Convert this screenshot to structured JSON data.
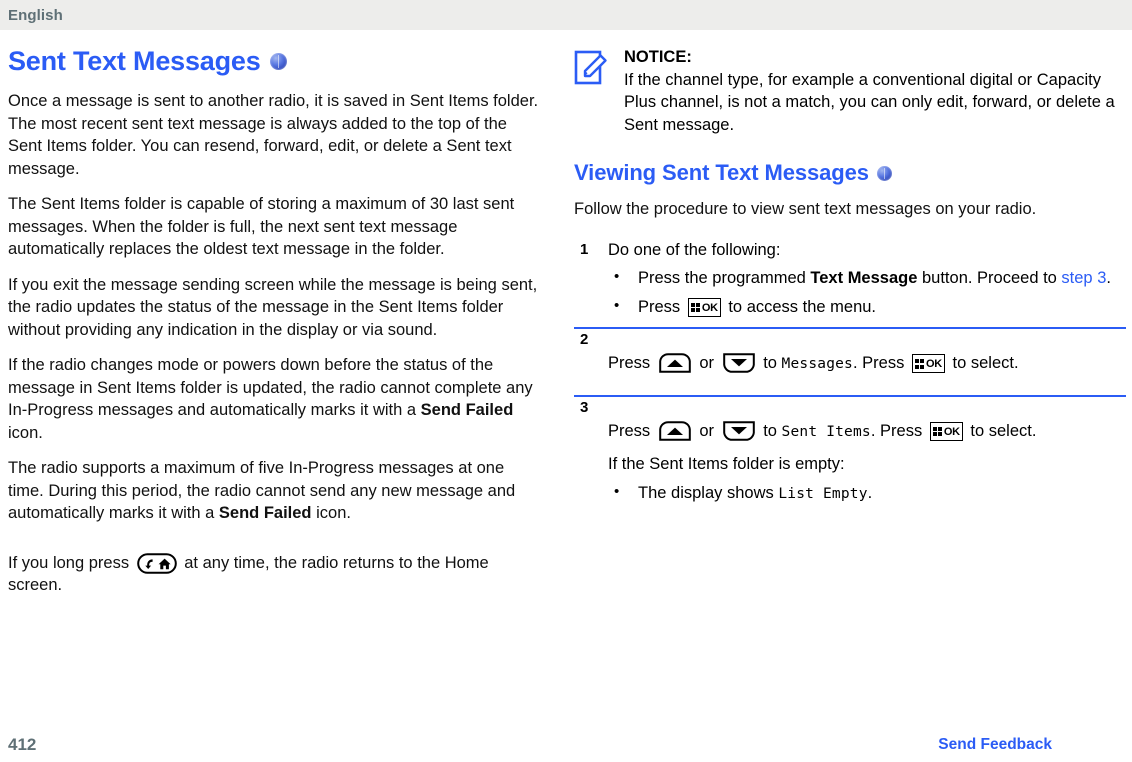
{
  "header": {
    "language": "English"
  },
  "colors": {
    "link": "#2b5cf5",
    "heading": "#2b5cf5",
    "header_text": "#5f7076",
    "header_bg": "#ededeb",
    "rule": "#2b5cf5"
  },
  "left_column": {
    "title": "Sent Text Messages",
    "paragraphs": [
      "Once a message is sent to another radio, it is saved in Sent Items folder. The most recent sent text message is always added to the top of the Sent Items folder. You can resend, forward, edit, or delete a Sent text message.",
      "The Sent Items folder is capable of storing a maximum of 30 last sent messages. When the folder is full, the next sent text message automatically replaces the oldest text message in the folder.",
      "If you exit the message sending screen while the message is being sent, the radio updates the status of the message in the Sent Items folder without providing any indication in the display or via sound."
    ],
    "para_send_failed_1": {
      "before": "If the radio changes mode or powers down before the status of the message in Sent Items folder is updated, the radio cannot complete any In-Progress messages and automatically marks it with a ",
      "bold": "Send Failed",
      "after": " icon."
    },
    "para_send_failed_2": {
      "before": "The radio supports a maximum of five In-Progress messages at one time. During this period, the radio cannot send any new message and automatically marks it with a ",
      "bold": "Send Failed",
      "after": " icon."
    },
    "para_home": {
      "before": "If you long press ",
      "after": " at any time, the radio returns to the Home screen.",
      "icon": "back-home-key-icon"
    }
  },
  "right_column": {
    "notice": {
      "icon": "notice-pencil-icon",
      "title": "NOTICE:",
      "text": "If the channel type, for example a conventional digital or Capacity Plus channel, is not a match, you can only edit, forward, or delete a Sent message."
    },
    "section_title": "Viewing Sent Text Messages",
    "intro": "Follow the procedure to view sent text messages on your radio.",
    "steps": [
      {
        "number": "1",
        "text": "Do one of the following:",
        "bullets": [
          {
            "before": "Press the programmed ",
            "bold": "Text Message",
            "after": " button. Proceed to ",
            "link": "step 3",
            "tail": "."
          },
          {
            "before": "Press ",
            "key": "ok-key-icon",
            "after": " to access the menu."
          }
        ]
      },
      {
        "number": "2",
        "segments": {
          "press": "Press ",
          "or": " or ",
          "to": " to ",
          "screen_value": "Messages",
          "press2": ". Press ",
          "select": " to select."
        }
      },
      {
        "number": "3",
        "segments": {
          "press": "Press ",
          "or": " or ",
          "to": " to ",
          "screen_value": "Sent Items",
          "press2": ". Press ",
          "select": " to select."
        },
        "sub_para": "If the Sent Items folder is empty:",
        "bullets": [
          {
            "before": "The display shows ",
            "screen_value": "List Empty",
            "after": "."
          }
        ]
      }
    ]
  },
  "footer": {
    "page_number": "412",
    "feedback_label": "Send Feedback"
  }
}
